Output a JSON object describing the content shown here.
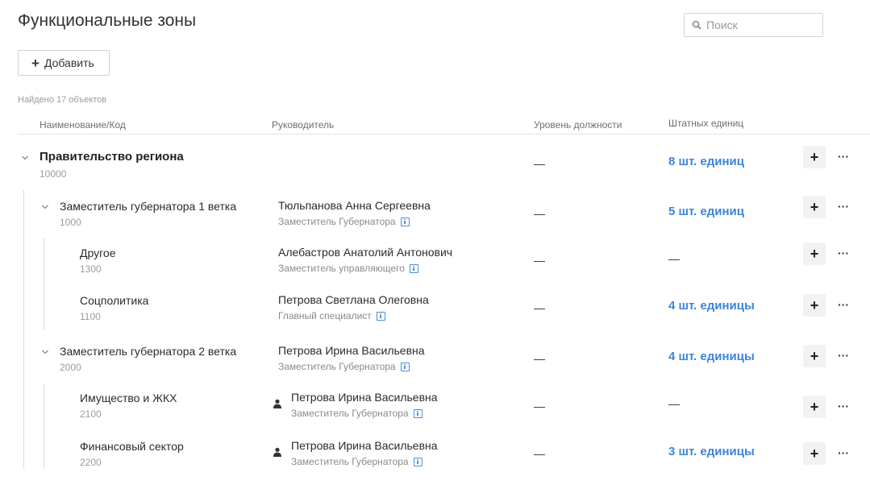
{
  "page": {
    "title": "Функциональные зоны"
  },
  "search": {
    "placeholder": "Поиск"
  },
  "toolbar": {
    "add_label": "Добавить"
  },
  "results": {
    "found_text": "Найдено 17 объектов"
  },
  "table": {
    "headers": {
      "name": "Наименование/Код",
      "head": "Руководитель",
      "level": "Уровень должности",
      "staff": "Штатных единиц"
    },
    "rows": [
      {
        "name": "Правительство региона",
        "code": "10000",
        "person": "",
        "position": "",
        "level": "—",
        "units": "8 шт. единиц"
      },
      {
        "name": "Заместитель губернатора 1 ветка",
        "code": "1000",
        "person": "Тюльпанова Анна Сергеевна",
        "position": "Заместитель Губернатора",
        "level": "—",
        "units": "5 шт. единиц"
      },
      {
        "name": "Другое",
        "code": "1300",
        "person": "Алебастров Анатолий Антонович",
        "position": "Заместитель управляющего",
        "level": "—",
        "units": "—"
      },
      {
        "name": "Соцполитика",
        "code": "1100",
        "person": "Петрова Светлана Олеговна",
        "position": "Главный специалист",
        "level": "—",
        "units": "4 шт. единицы"
      },
      {
        "name": "Заместитель губернатора 2 ветка",
        "code": "2000",
        "person": "Петрова Ирина Васильевна",
        "position": "Заместитель Губернатора",
        "level": "—",
        "units": "4 шт. единицы"
      },
      {
        "name": "Имущество и ЖКХ",
        "code": "2100",
        "person": "Петрова Ирина Васильевна",
        "position": "Заместитель Губернатора",
        "level": "—",
        "units": "—"
      },
      {
        "name": "Финансовый сектор",
        "code": "2200",
        "person": "Петрова Ирина Васильевна",
        "position": "Заместитель Губернатора",
        "level": "—",
        "units": "3 шт. единицы"
      }
    ]
  },
  "icons": {
    "search": "search-icon",
    "expand": "chevron-down-icon",
    "info": "info-icon",
    "user": "user-icon",
    "more": "more-icon"
  },
  "colors": {
    "accent": "#3b86d9"
  }
}
